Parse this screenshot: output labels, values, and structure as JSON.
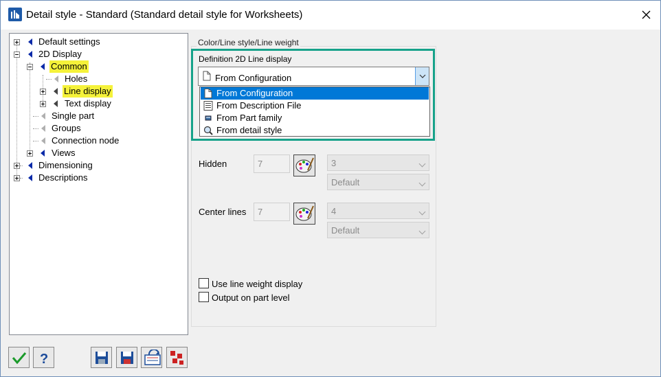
{
  "window": {
    "title": "Detail style - Standard (Standard detail style for Worksheets)"
  },
  "tree": {
    "items": [
      {
        "label": "Default settings"
      },
      {
        "label": "2D Display"
      },
      {
        "label": "Common"
      },
      {
        "label": "Holes"
      },
      {
        "label": "Line display"
      },
      {
        "label": "Text display"
      },
      {
        "label": "Single part"
      },
      {
        "label": "Groups"
      },
      {
        "label": "Connection node"
      },
      {
        "label": "Views"
      },
      {
        "label": "Dimensioning"
      },
      {
        "label": "Descriptions"
      }
    ]
  },
  "group": {
    "caption": "Color/Line style/Line weight",
    "definition_label": "Definition 2D Line display",
    "combo_value": "From Configuration",
    "dropdown_options": [
      {
        "label": "From Configuration",
        "icon": "document-icon",
        "selected": true
      },
      {
        "label": "From Description File",
        "icon": "description-file-icon",
        "selected": false
      },
      {
        "label": "From Part family",
        "icon": "part-family-icon",
        "selected": false
      },
      {
        "label": "From detail style",
        "icon": "magnifier-icon",
        "selected": false
      }
    ],
    "hidden": {
      "label": "Hidden",
      "color_value": "7",
      "style_value": "3",
      "weight_value": "Default"
    },
    "center_lines": {
      "label": "Center lines",
      "color_value": "7",
      "style_value": "4",
      "weight_value": "Default"
    },
    "checkboxes": {
      "use_line_weight": "Use line weight display",
      "output_part_level": "Output on part level"
    }
  },
  "colors": {
    "highlight": "#f5f23a",
    "selection": "#0078d7",
    "frame": "#16a28a"
  }
}
